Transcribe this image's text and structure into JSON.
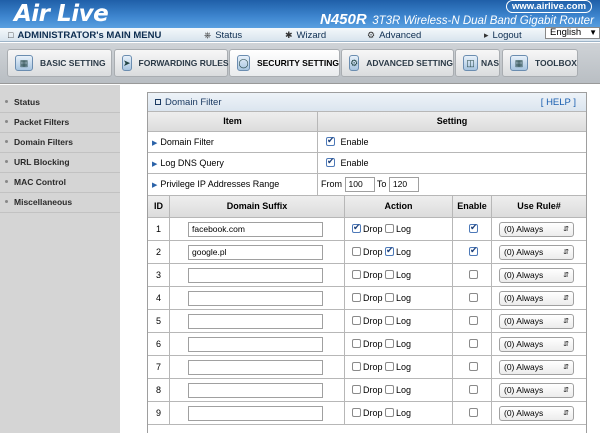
{
  "header": {
    "logo": "Air Live",
    "model": "N450R",
    "subtitle": "3T3R Wireless-N Dual Band Gigabit Router",
    "site": "www.airlive.com",
    "bg_color": "#3a80c8"
  },
  "menu": {
    "title": "ADMINISTRATOR's MAIN MENU",
    "items": [
      "Status",
      "Wizard",
      "Advanced",
      "Logout"
    ],
    "language": "English"
  },
  "tabs": [
    {
      "label": "BASIC SETTING",
      "icon": "basic-setting-icon"
    },
    {
      "label": "FORWARDING RULES",
      "icon": "forwarding-rules-icon"
    },
    {
      "label": "SECURITY SETTING",
      "icon": "security-setting-icon",
      "active": true
    },
    {
      "label": "ADVANCED SETTING",
      "icon": "advanced-setting-icon"
    },
    {
      "label": "NAS",
      "icon": "nas-icon"
    },
    {
      "label": "TOOLBOX",
      "icon": "toolbox-icon"
    }
  ],
  "sidebar": {
    "items": [
      "Status",
      "Packet Filters",
      "Domain Filters",
      "URL Blocking",
      "MAC Control",
      "Miscellaneous"
    ]
  },
  "panel": {
    "title": "Domain Filter",
    "help": "[ HELP ]",
    "header_item": "Item",
    "header_setting": "Setting",
    "settings": [
      {
        "label": "Domain Filter",
        "value": "Enable",
        "checked": true
      },
      {
        "label": "Log DNS Query",
        "value": "Enable",
        "checked": true
      }
    ],
    "privilege": {
      "label": "Privilege IP Addresses Range",
      "from_label": "From",
      "from": "100",
      "to_label": "To",
      "to": "120"
    },
    "columns": {
      "id": "ID",
      "domain": "Domain Suffix",
      "action": "Action",
      "enable": "Enable",
      "rule": "Use Rule#"
    },
    "drop_label": "Drop",
    "log_label": "Log",
    "rows": [
      {
        "id": "1",
        "domain": "facebook.com",
        "drop": true,
        "log": false,
        "enable": true,
        "rule": "(0) Always"
      },
      {
        "id": "2",
        "domain": "google.pl",
        "drop": false,
        "log": true,
        "enable": true,
        "rule": "(0) Always"
      },
      {
        "id": "3",
        "domain": "",
        "drop": false,
        "log": false,
        "enable": false,
        "rule": "(0) Always"
      },
      {
        "id": "4",
        "domain": "",
        "drop": false,
        "log": false,
        "enable": false,
        "rule": "(0) Always"
      },
      {
        "id": "5",
        "domain": "",
        "drop": false,
        "log": false,
        "enable": false,
        "rule": "(0) Always"
      },
      {
        "id": "6",
        "domain": "",
        "drop": false,
        "log": false,
        "enable": false,
        "rule": "(0) Always"
      },
      {
        "id": "7",
        "domain": "",
        "drop": false,
        "log": false,
        "enable": false,
        "rule": "(0) Always"
      },
      {
        "id": "8",
        "domain": "",
        "drop": false,
        "log": false,
        "enable": false,
        "rule": "(0) Always"
      },
      {
        "id": "9",
        "domain": "",
        "drop": false,
        "log": false,
        "enable": false,
        "rule": "(0) Always"
      }
    ]
  }
}
